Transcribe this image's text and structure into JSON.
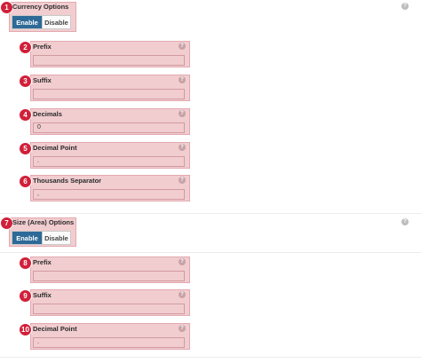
{
  "currency": {
    "badge": "1",
    "title": "Currency Options",
    "enable_label": "Enable",
    "disable_label": "Disable",
    "help": "?",
    "fields": [
      {
        "badge": "2",
        "label": "Prefix",
        "value": "",
        "help": "?"
      },
      {
        "badge": "3",
        "label": "Suffix",
        "value": "",
        "help": "?"
      },
      {
        "badge": "4",
        "label": "Decimals",
        "value": "0",
        "help": "?"
      },
      {
        "badge": "5",
        "label": "Decimal Point",
        "value": ".",
        "help": "?"
      },
      {
        "badge": "6",
        "label": "Thousands Separator",
        "value": ",",
        "help": "?"
      }
    ]
  },
  "size": {
    "badge": "7",
    "title": "Size (Area) Options",
    "enable_label": "Enable",
    "disable_label": "Disable",
    "help": "?",
    "fields": [
      {
        "badge": "8",
        "label": "Prefix",
        "value": "",
        "help": "?"
      },
      {
        "badge": "9",
        "label": "Suffix",
        "value": "",
        "help": "?"
      },
      {
        "badge": "10",
        "label": "Decimal Point",
        "value": ".",
        "help": "?"
      }
    ]
  }
}
